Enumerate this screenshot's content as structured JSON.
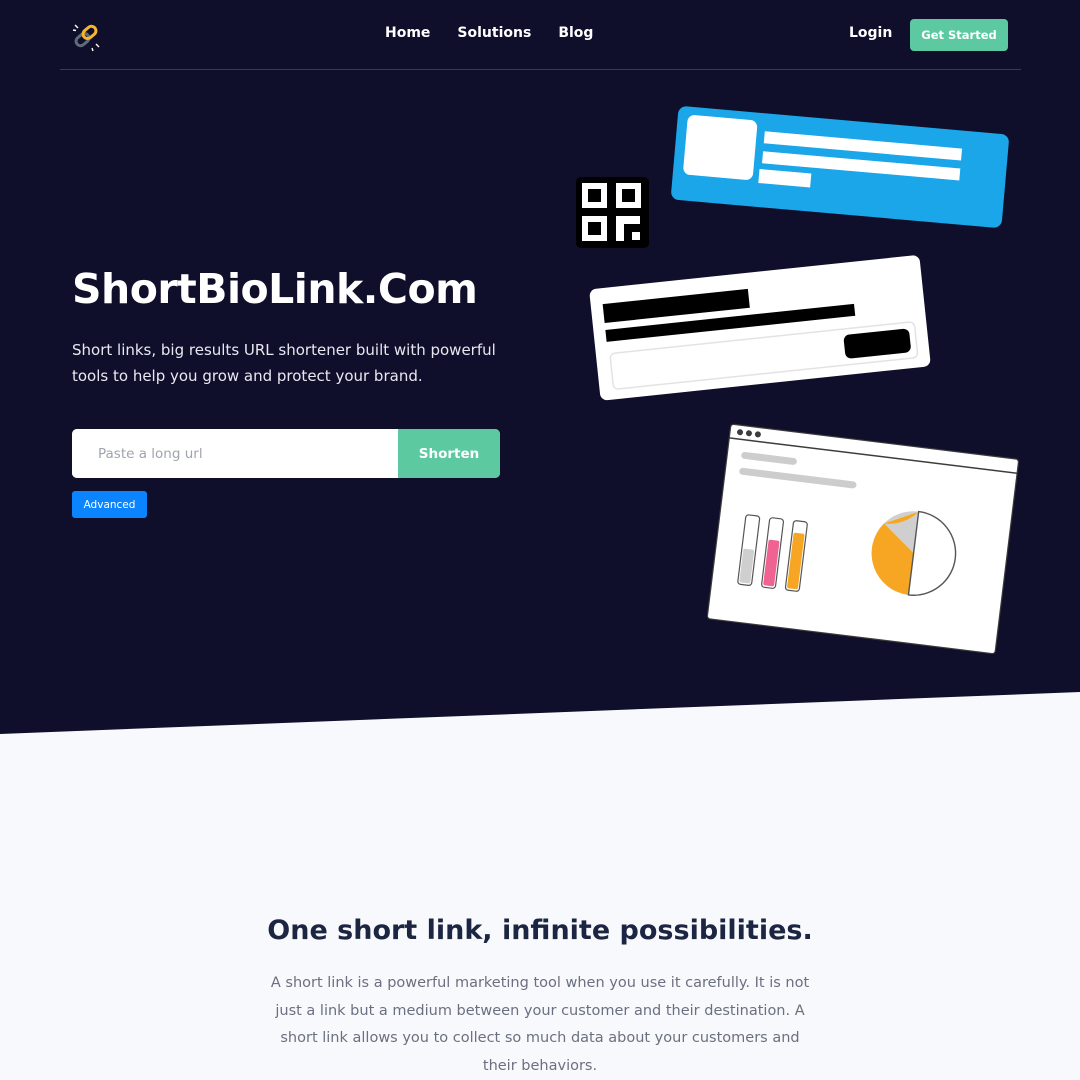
{
  "nav": {
    "logo_icon": "chain-link-icon",
    "links": [
      "Home",
      "Solutions",
      "Blog"
    ],
    "login": "Login",
    "cta": "Get Started"
  },
  "hero": {
    "title": "ShortBioLink.Com",
    "subtitle": "Short links, big results URL shortener built with powerful tools to help you grow and protect your brand.",
    "url_placeholder": "Paste a long url",
    "shorten_label": "Shorten",
    "advanced_label": "Advanced"
  },
  "section": {
    "title": "One short link, infinite possibilities.",
    "text": "A short link is a powerful marketing tool when you use it carefully. It is not just a link but a medium between your customer and their destination. A short link allows you to collect so much data about your customers and their behaviors."
  },
  "colors": {
    "hero_bg": "#0f0e2b",
    "accent_green": "#5cc9a0",
    "accent_blue": "#0a84ff",
    "card_blue": "#1aa6e8",
    "page_bg": "#f8f9fc"
  }
}
